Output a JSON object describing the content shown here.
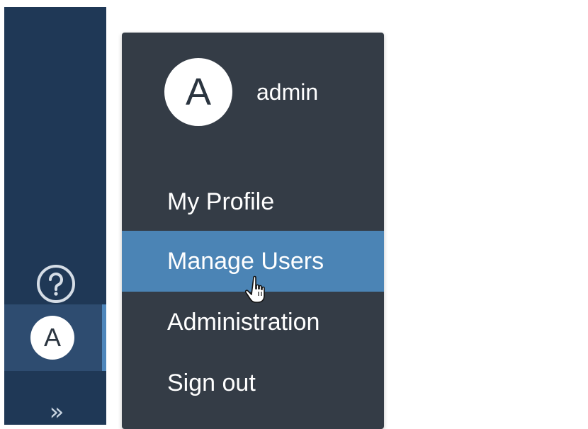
{
  "colors": {
    "sidebar_bg": "#1f3856",
    "sidebar_active_bg": "#2e4c70",
    "sidebar_accent": "#4e86bb",
    "menu_bg": "#343c46",
    "menu_active_bg": "#4b84b5"
  },
  "sidebar": {
    "help_icon": "question-circle-icon",
    "avatar_initial": "A",
    "expand_icon": "double-chevron-right-icon",
    "expand_glyph": "»"
  },
  "user_menu": {
    "avatar_initial": "A",
    "username": "admin",
    "items": [
      {
        "label": "My Profile",
        "active": false
      },
      {
        "label": "Manage Users",
        "active": true
      },
      {
        "label": "Administration",
        "active": false
      },
      {
        "label": "Sign out",
        "active": false
      }
    ]
  }
}
